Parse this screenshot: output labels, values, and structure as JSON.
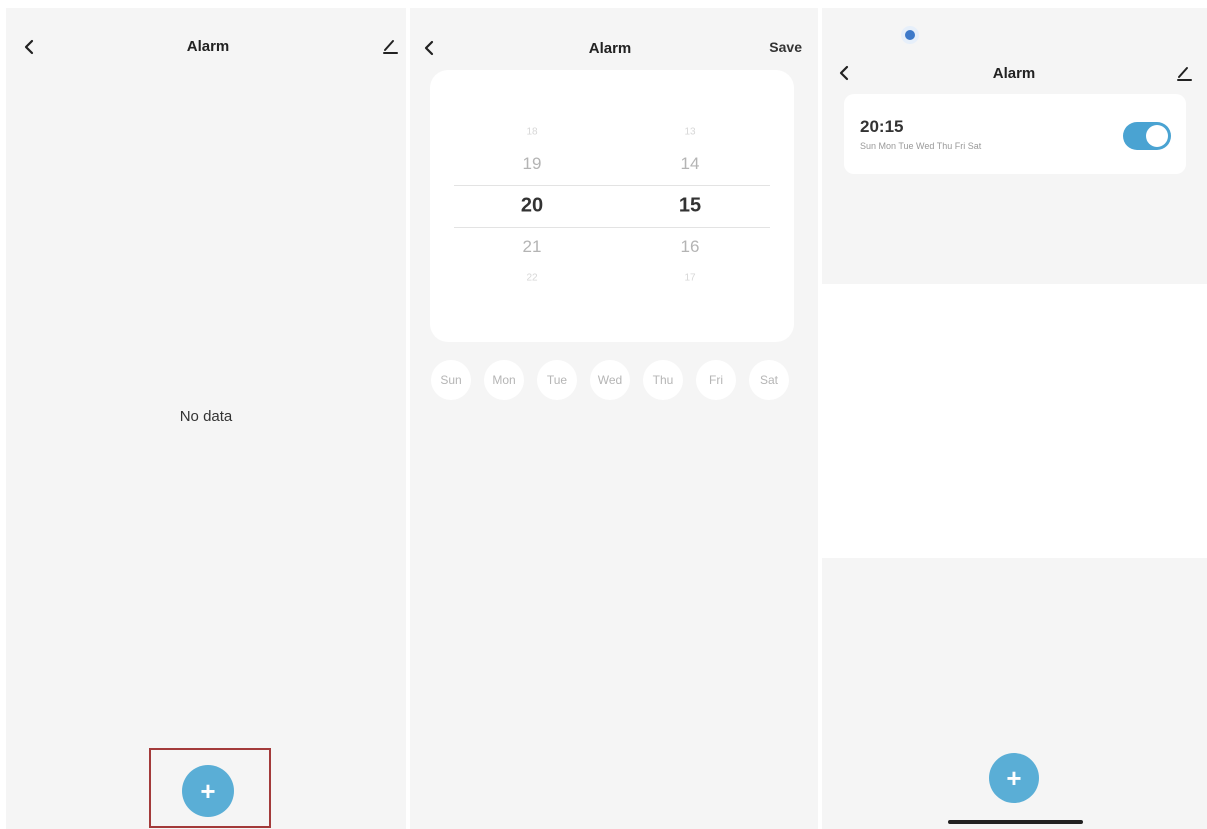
{
  "screen_empty": {
    "title": "Alarm",
    "back_icon": "chevron-left-icon",
    "edit_icon": "pencil-icon",
    "empty_text": "No data",
    "add_icon": "plus-icon",
    "add_label": "+"
  },
  "screen_picker": {
    "title": "Alarm",
    "back_icon": "chevron-left-icon",
    "save_label": "Save",
    "hours": [
      "18",
      "19",
      "20",
      "21",
      "22"
    ],
    "minutes": [
      "13",
      "14",
      "15",
      "16",
      "17"
    ],
    "selected_hour": "20",
    "selected_minute": "15",
    "days": [
      "Sun",
      "Mon",
      "Tue",
      "Wed",
      "Thu",
      "Fri",
      "Sat"
    ]
  },
  "screen_list": {
    "title": "Alarm",
    "back_icon": "chevron-left-icon",
    "edit_icon": "pencil-icon",
    "alarm": {
      "time": "20:15",
      "repeat": "Sun Mon Tue Wed Thu Fri Sat",
      "enabled": true
    },
    "add_icon": "plus-icon",
    "add_label": "+"
  },
  "colors": {
    "accent": "#5aaed6",
    "toggle_on": "#4aa3d2",
    "highlight_border": "#a33a3a",
    "background": "#f5f5f5",
    "card": "#ffffff"
  }
}
